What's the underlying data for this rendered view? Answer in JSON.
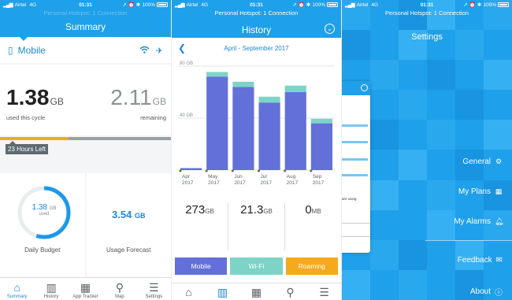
{
  "status_bar": {
    "carrier": "Airtel",
    "network": "4G",
    "time": "01:31",
    "battery": "100%"
  },
  "hotspot_text": "Personal Hotspot: 1 Connection",
  "summary": {
    "title": "Summary",
    "network_label": "Mobile",
    "used_value": "1.38",
    "used_unit": "GB",
    "used_caption": "used this cycle",
    "remaining_value": "2.11",
    "remaining_unit": "GB",
    "remaining_caption": "remaining",
    "cycle_progress": 0.4,
    "time_left": "23 Hours Left",
    "daily_budget": {
      "value": "1.38",
      "unit": "GB",
      "sub": "used",
      "caption": "Daily Budget",
      "fraction": 0.55
    },
    "forecast": {
      "value": "3.54",
      "unit": "GB",
      "caption": "Usage Forecast"
    },
    "tabs": [
      {
        "label": "Summary",
        "icon": "home-icon"
      },
      {
        "label": "History",
        "icon": "bar-chart-icon"
      },
      {
        "label": "App Tracker",
        "icon": "grid-icon"
      },
      {
        "label": "Map",
        "icon": "map-pin-icon"
      },
      {
        "label": "Settings",
        "icon": "list-icon"
      }
    ]
  },
  "history": {
    "title": "History",
    "range": "April - September 2017",
    "stats": [
      {
        "value": "273",
        "unit": "GB"
      },
      {
        "value": "21.3",
        "unit": "GB"
      },
      {
        "value": "0",
        "unit": "MB"
      }
    ],
    "segments": [
      {
        "label": "Mobile",
        "color": "#6370d9"
      },
      {
        "label": "Wi-Fi",
        "color": "#7dd4c6"
      },
      {
        "label": "Roaming",
        "color": "#f5aa1c"
      }
    ],
    "tabs": [
      "Summary",
      "History",
      "App Tracker",
      "Map",
      "Settings"
    ]
  },
  "chart_data": {
    "type": "bar",
    "categories": [
      "Apr 2017",
      "May 2017",
      "Jun 2017",
      "Jul 2017",
      "Aug 2017",
      "Sep 2017"
    ],
    "series": [
      {
        "name": "Mobile",
        "values": [
          1.5,
          72,
          64,
          52,
          60,
          36
        ]
      },
      {
        "name": "Wi-Fi",
        "values": [
          0,
          3.5,
          4,
          4.5,
          5,
          3.5
        ]
      }
    ],
    "ylim": [
      0,
      80
    ],
    "yticks": [
      "80 GB",
      "40 GB"
    ],
    "colors": [
      "#6370d9",
      "#7dd4c6"
    ],
    "grid": true
  },
  "settings": {
    "title": "Settings",
    "items": [
      {
        "label": "General",
        "icon": "gear-icon"
      },
      {
        "label": "My Plans",
        "icon": "calendar-icon"
      },
      {
        "label": "My Alarms",
        "icon": "bell-icon"
      },
      {
        "label": "Feedback",
        "icon": "mail-icon"
      },
      {
        "label": "About",
        "icon": "info-icon"
      }
    ],
    "preview_text": "are using"
  }
}
